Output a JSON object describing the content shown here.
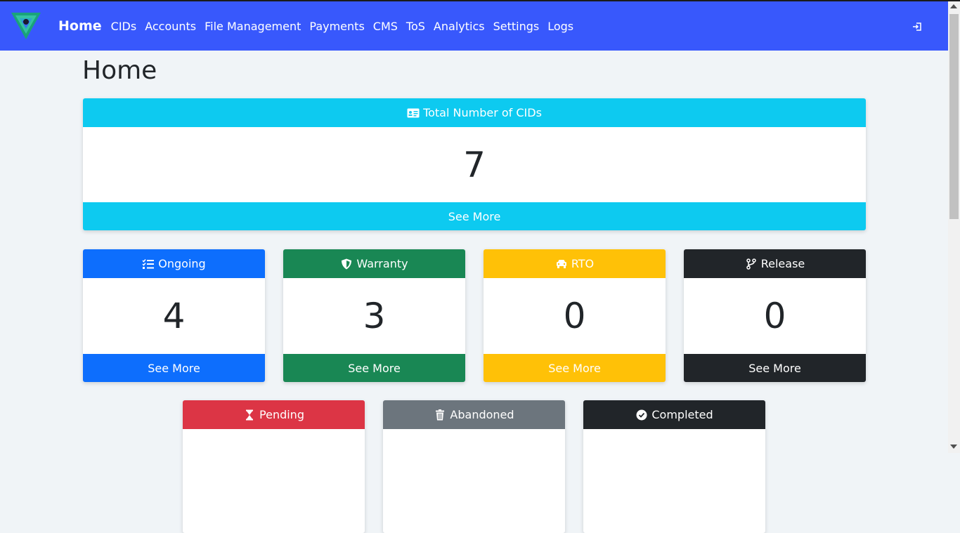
{
  "nav": {
    "items": [
      {
        "label": "Home",
        "active": true
      },
      {
        "label": "CIDs"
      },
      {
        "label": "Accounts"
      },
      {
        "label": "File Management"
      },
      {
        "label": "Payments"
      },
      {
        "label": "CMS"
      },
      {
        "label": "ToS"
      },
      {
        "label": "Analytics"
      },
      {
        "label": "Settings"
      },
      {
        "label": "Logs"
      }
    ],
    "logout_icon": "sign-in-icon"
  },
  "page": {
    "title": "Home"
  },
  "total": {
    "header": "Total Number of CIDs",
    "value": "7",
    "footer": "See More",
    "icon": "id-card-icon",
    "color": "#0dcaf0"
  },
  "cards": [
    {
      "header": "Ongoing",
      "value": "4",
      "footer": "See More",
      "icon": "list-check-icon",
      "color": "#0d6efd",
      "text": "#ffffff"
    },
    {
      "header": "Warranty",
      "value": "3",
      "footer": "See More",
      "icon": "shield-icon",
      "color": "#198754",
      "text": "#ffffff"
    },
    {
      "header": "RTO",
      "value": "0",
      "footer": "See More",
      "icon": "car-icon",
      "color": "#ffc107",
      "text": "#ffffff"
    },
    {
      "header": "Release",
      "value": "0",
      "footer": "See More",
      "icon": "code-branch-icon",
      "color": "#212529",
      "text": "#ffffff"
    },
    {
      "header": "Pending",
      "icon": "hourglass-icon",
      "color": "#dc3545",
      "text": "#ffffff"
    },
    {
      "header": "Abandoned",
      "icon": "trash-icon",
      "color": "#6c757d",
      "text": "#ffffff"
    },
    {
      "header": "Completed",
      "icon": "check-circle-icon",
      "color": "#212529",
      "text": "#ffffff"
    }
  ]
}
